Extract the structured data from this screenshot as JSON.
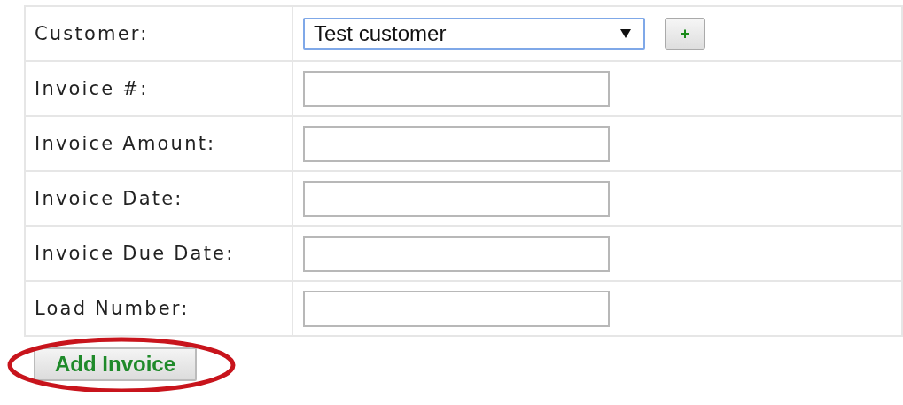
{
  "form": {
    "rows": [
      {
        "kind": "select",
        "label": "Customer:",
        "value": "Test customer",
        "add_button": "+"
      },
      {
        "kind": "text",
        "label": "Invoice #:"
      },
      {
        "kind": "text",
        "label": "Invoice Amount:"
      },
      {
        "kind": "text",
        "label": "Invoice Date:"
      },
      {
        "kind": "text",
        "label": "Invoice Due Date:"
      },
      {
        "kind": "text",
        "label": "Load Number:"
      }
    ],
    "submit_button": {
      "label": "Add Invoice",
      "highlighted": true
    }
  }
}
